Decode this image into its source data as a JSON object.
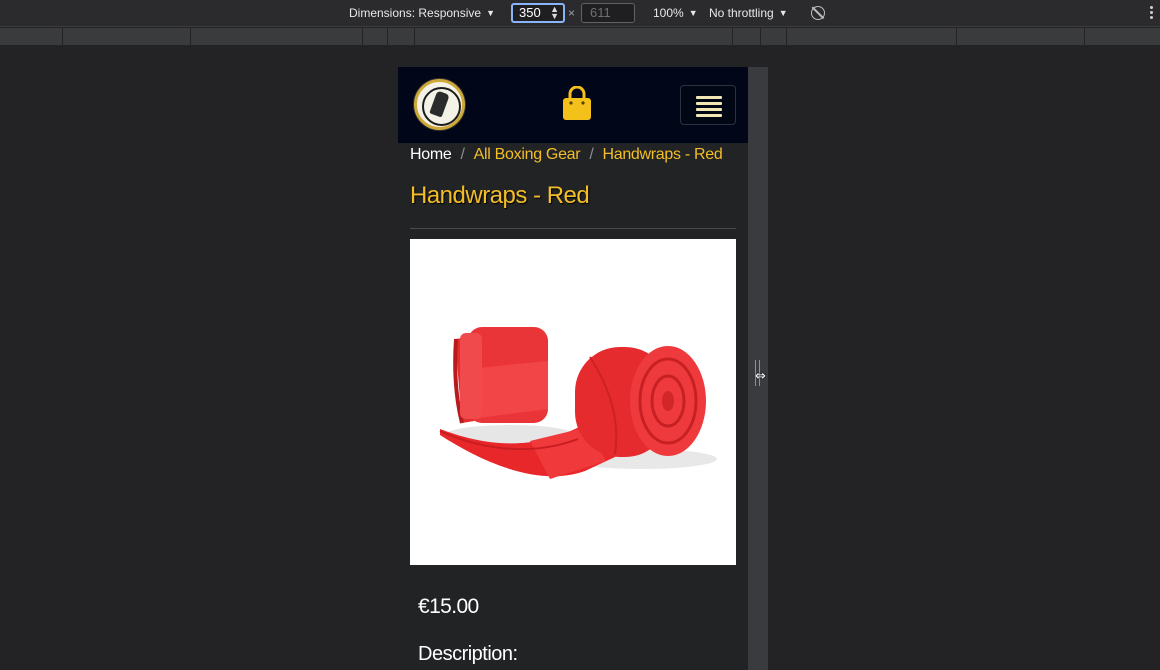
{
  "devtools": {
    "dimensions_label": "Dimensions: Responsive",
    "width_value": "350",
    "times_symbol": "×",
    "height_placeholder": "611",
    "zoom_label": "100%",
    "throttling_label": "No throttling"
  },
  "nav": {
    "logo_icon": "club-logo",
    "bag_icon": "shopping-bag-icon",
    "menu_icon": "hamburger-menu-icon"
  },
  "breadcrumb": {
    "home": "Home",
    "separator": "/",
    "category": "All Boxing Gear",
    "current": "Handwraps - Red"
  },
  "product": {
    "title": "Handwraps - Red",
    "image_alt": "red boxing handwraps",
    "price": "€15.00",
    "description_heading": "Description:"
  },
  "colors": {
    "accent": "#f3be27",
    "nav_bg": "#010619",
    "page_bg": "#222325",
    "devtools_bg": "#2b2b2d"
  }
}
